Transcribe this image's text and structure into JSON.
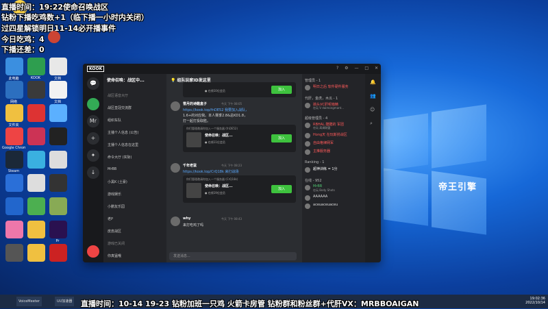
{
  "overlay": {
    "line1": "直播时间：19:22使命召唤战区",
    "line2": "钻粉下播吃鸡数+1（临下播一小时内关闭）",
    "line3": "过四星解锁明日11-14必开播事件",
    "line4": "今日吃鸡：4",
    "line5": "下播还差：0",
    "brand": "帝王引擎",
    "bottom": "直播时间：10-14 19-23  钻粉加班一只鸡 火箭卡房管 钻粉群和粉丝群+代肝VX：MRBBOAIGAN"
  },
  "desktop_icons": [
    {
      "label": "此电脑",
      "color": "#3b8fe0"
    },
    {
      "label": "KOOK",
      "color": "#2e9e4f"
    },
    {
      "label": "文档",
      "color": "#e8e8e8"
    },
    {
      "label": "网络",
      "color": "#2c6fbf"
    },
    {
      "label": "",
      "color": "#3a3a3a"
    },
    {
      "label": "文档",
      "color": "#f2f2f2"
    },
    {
      "label": "文件夹",
      "color": "#f0c040"
    },
    {
      "label": "",
      "color": "#d33"
    },
    {
      "label": "",
      "color": "#5bb0ff"
    },
    {
      "label": "Google Chrome",
      "color": "#e44"
    },
    {
      "label": "",
      "color": "#c35"
    },
    {
      "label": "",
      "color": "#222"
    },
    {
      "label": "Steam",
      "color": "#1b2838"
    },
    {
      "label": "",
      "color": "#3ab0e0"
    },
    {
      "label": "",
      "color": "#ddd"
    },
    {
      "label": "",
      "color": "#2a6fd8"
    },
    {
      "label": "",
      "color": "#ddd"
    },
    {
      "label": "",
      "color": "#333"
    },
    {
      "label": "",
      "color": "#2266cc"
    },
    {
      "label": "",
      "color": "#4caf50"
    },
    {
      "label": "",
      "color": "#8a5"
    },
    {
      "label": "",
      "color": "#e7a"
    },
    {
      "label": "",
      "color": "#f0c040"
    },
    {
      "label": "Pr",
      "color": "#2a1150"
    },
    {
      "label": "",
      "color": "#555"
    },
    {
      "label": "",
      "color": "#f0c040"
    },
    {
      "label": "",
      "color": "#c22"
    }
  ],
  "app": {
    "logo": "KOOK",
    "server_name": "使命召唤：战区中...",
    "channel_title": "💡 组队玩家ID发这里",
    "rail": [
      {
        "label": "💬"
      },
      {
        "label": "Mr"
      },
      {
        "label": "+"
      },
      {
        "label": "✦"
      },
      {
        "label": "↓"
      }
    ],
    "channels": [
      {
        "label": "战区语音大厅",
        "dim": true
      },
      {
        "label": "战区皇冠交流群",
        "dim": false
      },
      {
        "label": "组织车队",
        "dim": false
      },
      {
        "label": "主播个人信息 (公告)",
        "dim": false
      },
      {
        "label": "主播个人信息在这里",
        "dim": false
      },
      {
        "label": "命令大厅 (实际)",
        "dim": false
      },
      {
        "label": "MrBB",
        "dim": false
      },
      {
        "label": "小黑K (土豪)",
        "dim": false
      },
      {
        "label": "游戏娱乐",
        "dim": false
      },
      {
        "label": "小鹏友乐园",
        "dim": false
      },
      {
        "label": "老P",
        "dim": false
      },
      {
        "label": "皮皮战区",
        "dim": false
      },
      {
        "label": "游戏已关闭",
        "dim": true
      }
    ],
    "bottom_user": "你真猛哦",
    "messages": [
      {
        "name": "雪月的诗酷盒子",
        "time": "今天 下午 08:05",
        "text1": "https://kook.top/fnDE52 我要加入战队，",
        "text2": "1.6+的对应我。本人赛季2.8&总KD1.8，",
        "text3": "打一起打投取胜。",
        "card_sub": "你们管理邀请你加入一个服务器 (fnDE52)",
        "card_title": "使命召唤：战区...",
        "card_count": "● 在线11位会员",
        "join": "加入"
      },
      {
        "name": "千年老鼠",
        "time": "今天 下午 08:23",
        "text1": "https://kook.top/CrQ18k 来打战场",
        "text2": "",
        "text3": "",
        "card_sub": "你们管理邀请你加入一个服务器 (CrQ18k)",
        "card_title": "使命召唤：战区...",
        "card_count": "● 在线19位会员",
        "join": "加入"
      },
      {
        "name": "why",
        "time": "今天 下午 08:43",
        "text1": "来打吃鸡了吗",
        "text2": "",
        "text3": "",
        "card_sub": "",
        "card_title": "",
        "card_count": "",
        "join": ""
      }
    ],
    "top_card": {
      "count": "● 在线10位会员",
      "join": "加入"
    },
    "input_placeholder": "发送消息...",
    "member_groups": [
      {
        "head": "管理员 - 1",
        "members": [
          {
            "name": "明日之后 软件硬件服务",
            "sub": "",
            "color": "#ff5a5a"
          }
        ]
      },
      {
        "head": "代肝，金虎，木瓜 - 1",
        "members": [
          {
            "name": "搞头VC肝呢咖精",
            "sub": "在玩 V daimongmant...",
            "color": "#ff5a5a"
          }
        ]
      },
      {
        "head": "超级管理员 - 4",
        "members": [
          {
            "name": "RBHAL 酷酷的 军团",
            "sub": "在玩 高调联盟",
            "color": "#ff5a5a"
          },
          {
            "name": "Hong天 在玩斯捞战区",
            "sub": "",
            "color": "#ff5a5a"
          },
          {
            "name": "自由格律网军",
            "sub": "",
            "color": "#ff5a5a"
          },
          {
            "name": "主推服务器",
            "sub": "",
            "color": "#ff5a5a"
          }
        ]
      },
      {
        "head": "Ranking - 1",
        "members": [
          {
            "name": "超神训练 = 1分",
            "sub": "",
            "color": "#ffffff"
          }
        ]
      },
      {
        "head": "在线 - 952",
        "members": [
          {
            "name": "MrBB",
            "sub": "在玩 Body Shots",
            "color": "#4fc36f"
          },
          {
            "name": "AAAAAA",
            "sub": "",
            "color": "#dddddd"
          },
          {
            "name": "aceuaceuaceu",
            "sub": "",
            "color": "#dddddd"
          }
        ]
      }
    ]
  },
  "taskbar": {
    "items": [
      "VoiceMeeter",
      "UU加速器"
    ],
    "time": "19:02:36",
    "date": "2022/10/14"
  }
}
